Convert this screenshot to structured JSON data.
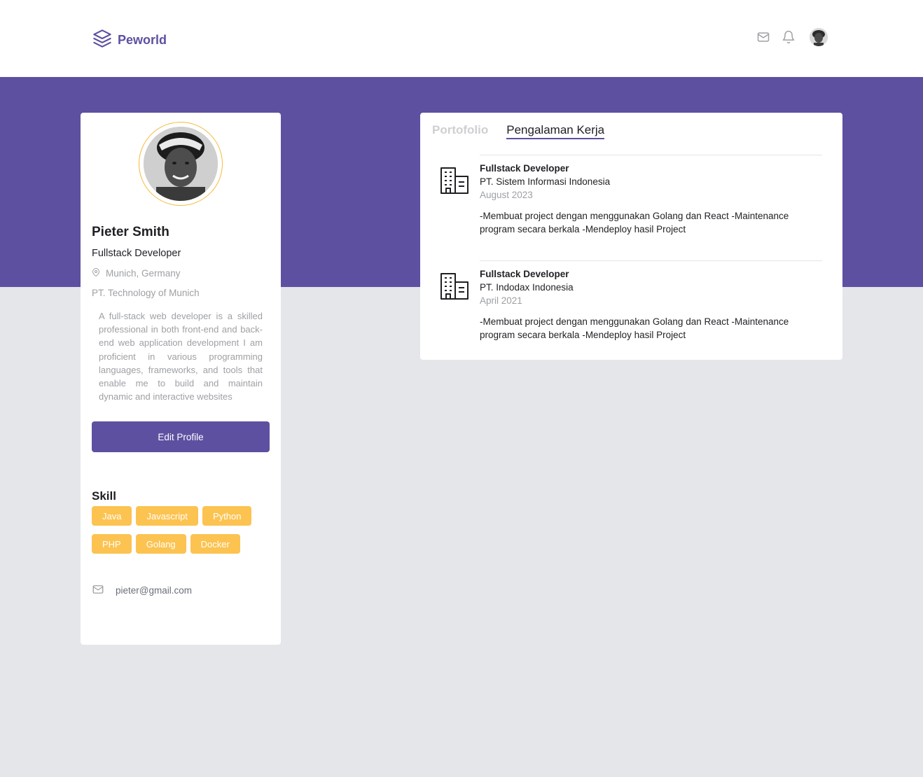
{
  "navbar": {
    "brand": "Peworld",
    "icons": [
      "mail-icon",
      "bell-icon"
    ],
    "accent_color": "#5e50a1"
  },
  "profile": {
    "name": "Pieter Smith",
    "role": "Fullstack Developer",
    "location": "Munich, Germany",
    "company": "PT. Technology of Munich",
    "bio": "A full-stack web developer is a skilled professional in both front-end and back-end web application development I am proficient in various programming languages, frameworks, and tools that enable me to build and maintain dynamic and interactive websites",
    "edit_button": "Edit Profile",
    "skill_title": "Skill",
    "skills": [
      "Java",
      "Javascript",
      "Python",
      "PHP",
      "Golang",
      "Docker"
    ],
    "email": "pieter@gmail.com",
    "skill_color": "#fbb017"
  },
  "tabs": {
    "portfolio": "Portofolio",
    "experience": "Pengalaman Kerja",
    "active": "Pengalaman Kerja"
  },
  "experience": [
    {
      "job": "Fullstack Developer",
      "company": "PT. Sistem Informasi Indonesia",
      "date": "August 2023",
      "description": "-Membuat project dengan menggunakan Golang dan React -Maintenance program secara berkala -Mendeploy hasil Project"
    },
    {
      "job": "Fullstack Developer",
      "company": "PT. Indodax Indonesia",
      "date": "April 2021",
      "description": "-Membuat project dengan menggunakan Golang dan React -Maintenance program secara berkala -Mendeploy hasil Project"
    }
  ]
}
